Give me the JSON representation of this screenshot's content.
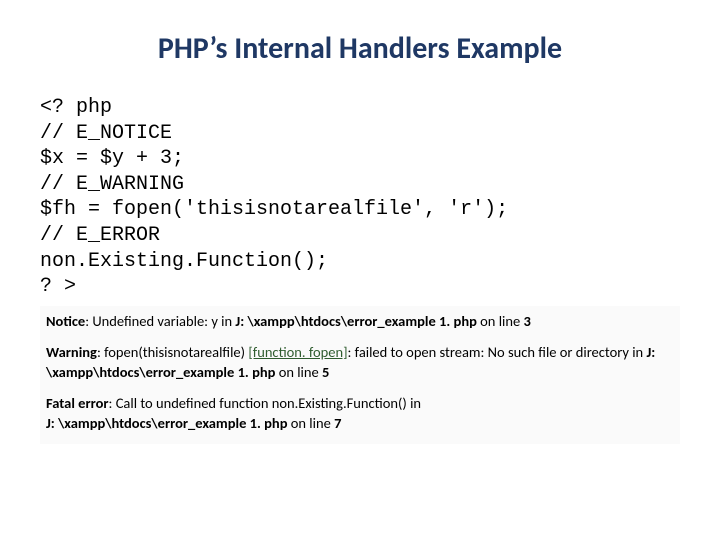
{
  "title": "PHP’s Internal Handlers Example",
  "code": {
    "l1": "<? php",
    "l2": "// E_NOTICE",
    "l3": "$x = $y + 3;",
    "l4": "// E_WARNING",
    "l5": "$fh = fopen('thisisnotarealfile', 'r');",
    "l6": "// E_ERROR",
    "l7": "non.Existing.Function();",
    "l8": "? >"
  },
  "output": {
    "notice": {
      "label": "Notice",
      "mid": ": Undefined variable: y in ",
      "path": "J: \\xampp\\htdocs\\error_example 1. php ",
      "online": "on line ",
      "line": "3"
    },
    "warning": {
      "label": "Warning",
      "pre": ": fopen(thisisnotarealfile) ",
      "link": "[function. fopen]",
      "mid": ": failed to open stream: No such file or directory in ",
      "path": "J: \\xampp\\htdocs\\error_example 1. php ",
      "online": "on line ",
      "line": "5"
    },
    "fatal": {
      "label": "Fatal error",
      "mid": ": Call to undefined function non.Existing.Function() in ",
      "path": "J: \\xampp\\htdocs\\error_example 1. php ",
      "online": "on line ",
      "line": "7"
    }
  }
}
